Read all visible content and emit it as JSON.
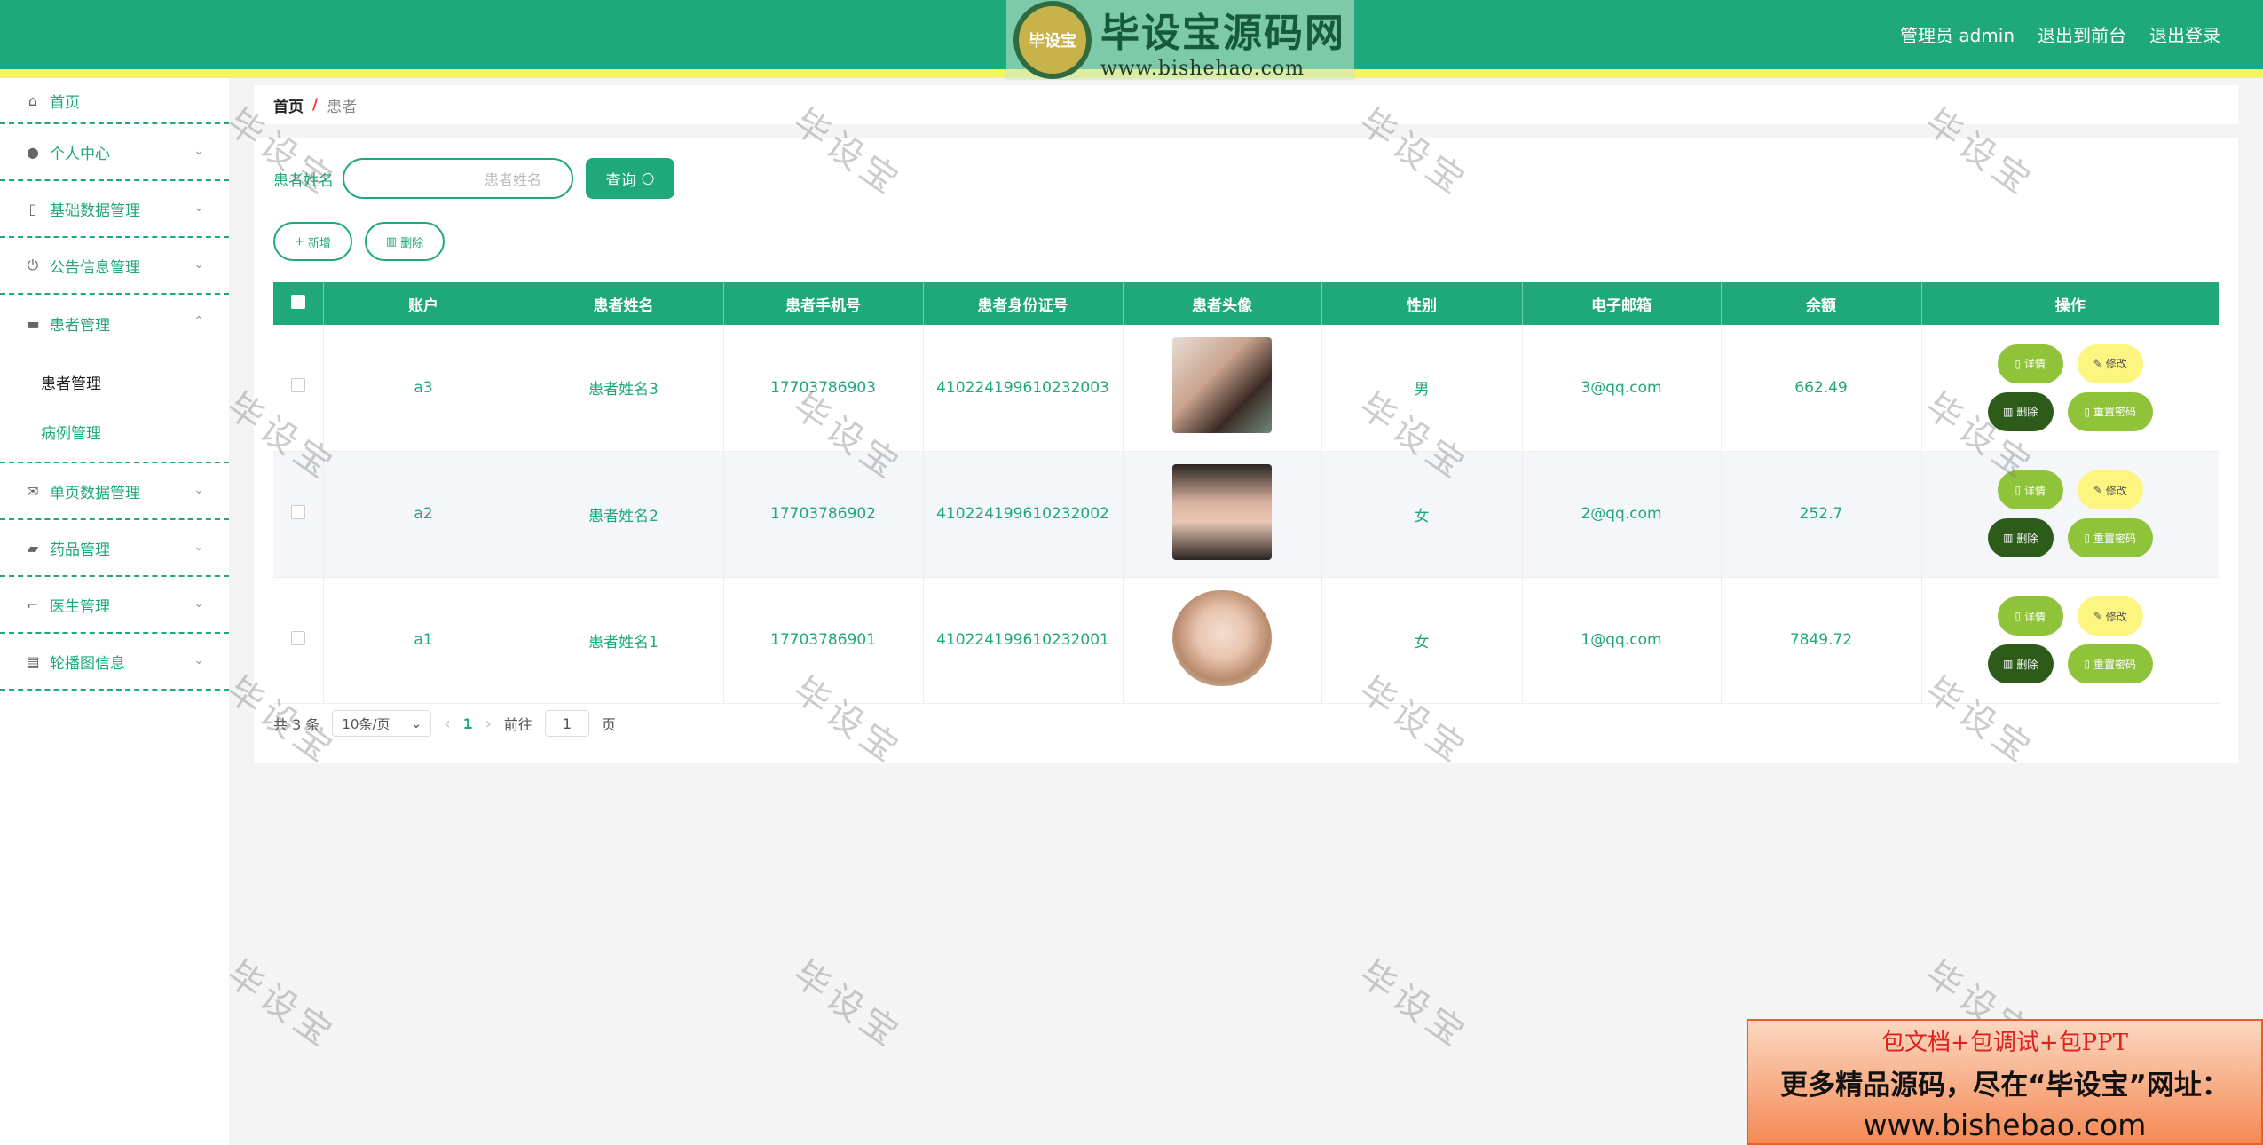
{
  "header": {
    "logo_badge": "毕设宝",
    "logo_cn": "毕设宝源码网",
    "logo_url": "www.bishehao.com",
    "user": "管理员 admin",
    "to_front": "退出到前台",
    "logout": "退出登录"
  },
  "sidebar": {
    "items": [
      {
        "label": "首页",
        "icon": "home-icon"
      },
      {
        "label": "个人中心",
        "icon": "user-icon"
      },
      {
        "label": "基础数据管理",
        "icon": "mic-icon"
      },
      {
        "label": "公告信息管理",
        "icon": "power-icon"
      },
      {
        "label": "患者管理",
        "icon": "monitor-icon"
      },
      {
        "label": "单页数据管理",
        "icon": "mail-icon"
      },
      {
        "label": "药品管理",
        "icon": "ticket-icon"
      },
      {
        "label": "医生管理",
        "icon": "crop-icon"
      },
      {
        "label": "轮播图信息",
        "icon": "clipboard-icon"
      }
    ],
    "sub_items": [
      "患者管理",
      "病例管理"
    ]
  },
  "breadcrumb": {
    "home": "首页",
    "sep": "/",
    "current": "患者"
  },
  "search": {
    "label": "患者姓名",
    "placeholder": "患者姓名",
    "button": "查询"
  },
  "actions": {
    "add": "新增",
    "delete": "删除"
  },
  "table": {
    "headers": [
      "账户",
      "患者姓名",
      "患者手机号",
      "患者身份证号",
      "患者头像",
      "性别",
      "电子邮箱",
      "余额",
      "操作"
    ],
    "rows": [
      {
        "account": "a3",
        "name": "患者姓名3",
        "phone": "17703786903",
        "id_card": "410224199610232003",
        "gender": "男",
        "email": "3@qq.com",
        "balance": "662.49"
      },
      {
        "account": "a2",
        "name": "患者姓名2",
        "phone": "17703786902",
        "id_card": "410224199610232002",
        "gender": "女",
        "email": "2@qq.com",
        "balance": "252.7"
      },
      {
        "account": "a1",
        "name": "患者姓名1",
        "phone": "17703786901",
        "id_card": "410224199610232001",
        "gender": "女",
        "email": "1@qq.com",
        "balance": "7849.72"
      }
    ],
    "ops": {
      "detail": "详情",
      "edit": "修改",
      "delete": "删除",
      "reset": "重置密码"
    }
  },
  "pager": {
    "total": "共 3 条",
    "size": "10条/页",
    "page": "1",
    "goto": "前往",
    "goto_value": "1",
    "page_unit": "页"
  },
  "watermark": "毕设宝",
  "ad": {
    "line1": "包文档+包调试+包PPT",
    "line2": "更多精品源码，尽在“毕设宝”网址：",
    "line3": "www.bishebao.com"
  },
  "colors": {
    "primary": "#1fa97a",
    "accent_stripe": "#f4f46a",
    "detail": "#8fc33a",
    "edit": "#fcf580",
    "delete": "#2d5b1a"
  }
}
